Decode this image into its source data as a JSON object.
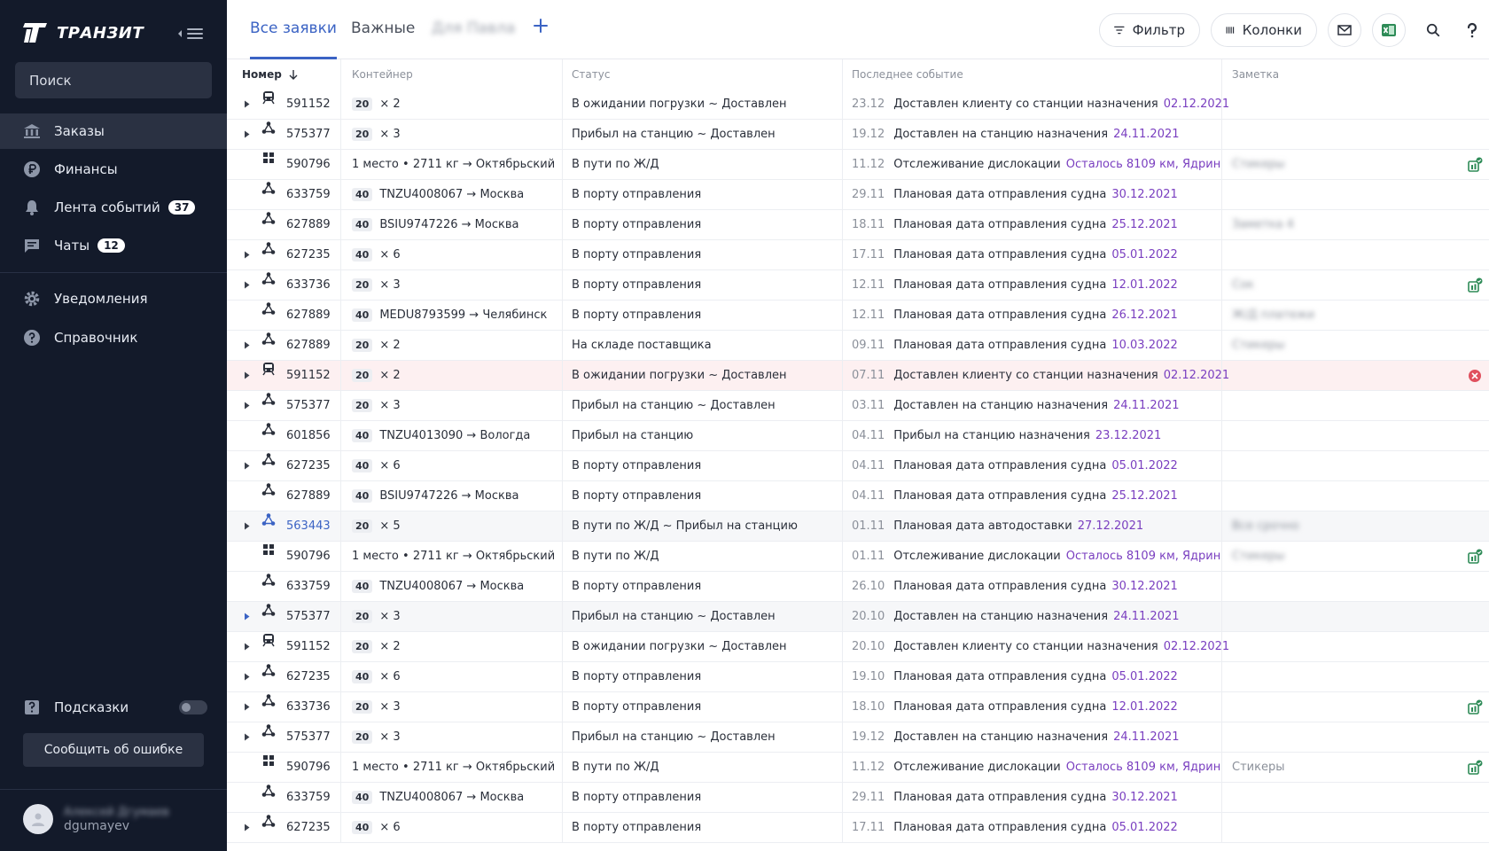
{
  "app": {
    "title": "ТРАНЗИТ"
  },
  "sidebar": {
    "search_placeholder": "Поиск",
    "items": [
      {
        "label": "Заказы",
        "icon": "bank-icon",
        "badge": "",
        "active": true
      },
      {
        "label": "Финансы",
        "icon": "ruble-icon",
        "badge": ""
      },
      {
        "label": "Лента событий",
        "icon": "bell-icon",
        "badge": "37"
      },
      {
        "label": "Чаты",
        "icon": "chat-icon",
        "badge": "12"
      },
      {
        "label": "Уведомления",
        "icon": "gear-icon",
        "badge": ""
      },
      {
        "label": "Справочник",
        "icon": "help-icon",
        "badge": ""
      }
    ],
    "hints_label": "Подсказки",
    "report_label": "Сообщить об ошибке",
    "user": {
      "name": "Алексей Дгумаев",
      "login": "dgumayev"
    }
  },
  "tabs": [
    {
      "label": "Все заявки",
      "active": true
    },
    {
      "label": "Важные"
    },
    {
      "label": "Для Павла",
      "blurred": true
    }
  ],
  "toolbar": {
    "filter_label": "Фильтр",
    "columns_label": "Колонки"
  },
  "table": {
    "columns": [
      "Номер",
      "Контейнер",
      "Статус",
      "Последнее событие",
      "Заметка"
    ],
    "rows": [
      {
        "expand": true,
        "icon": "train-icon",
        "num": "591152",
        "size": "20",
        "cont": "× 2",
        "status": "В ожидании погрузки ~ Доставлен",
        "date": "23.12",
        "event": "Доставлен клиенту со станции назначения",
        "evdate": "02.12.2021",
        "note": "",
        "action": ""
      },
      {
        "expand": true,
        "icon": "network-icon",
        "num": "575377",
        "size": "20",
        "cont": "× 3",
        "status": "Прибыл на станцию ~ Доставлен",
        "date": "19.12",
        "event": "Доставлен на станцию назначения",
        "evdate": "24.11.2021",
        "note": "",
        "action": ""
      },
      {
        "expand": false,
        "icon": "grid-icon",
        "num": "590796",
        "size": "",
        "cont": "1 место • 2711 кг → Октябрьский",
        "status": "В пути по Ж/Д",
        "date": "11.12",
        "event": "Отслеживание дислокации",
        "evdate": "Осталось 8109 км, Ядрин",
        "note": "Стикеры",
        "noteBlur": true,
        "action": "doc"
      },
      {
        "expand": false,
        "icon": "network-icon",
        "num": "633759",
        "size": "40",
        "cont": "TNZU4008067 → Москва",
        "status": "В порту отправления",
        "date": "29.11",
        "event": "Плановая дата отправления судна",
        "evdate": "30.12.2021",
        "note": "",
        "action": ""
      },
      {
        "expand": false,
        "icon": "network-icon",
        "num": "627889",
        "size": "40",
        "cont": "BSIU9747226 → Москва",
        "status": "В порту отправления",
        "date": "18.11",
        "event": "Плановая дата отправления судна",
        "evdate": "25.12.2021",
        "note": "Заметка 4",
        "noteBlur": true,
        "action": ""
      },
      {
        "expand": true,
        "icon": "network-icon",
        "num": "627235",
        "size": "40",
        "cont": "× 6",
        "status": "В порту отправления",
        "date": "17.11",
        "event": "Плановая дата отправления судна",
        "evdate": "05.01.2022",
        "note": "",
        "action": ""
      },
      {
        "expand": true,
        "icon": "network-icon",
        "num": "633736",
        "size": "20",
        "cont": "× 3",
        "status": "В порту отправления",
        "date": "12.11",
        "event": "Плановая дата отправления судна",
        "evdate": "12.01.2022",
        "note": "Сок",
        "noteBlur": true,
        "action": "doc"
      },
      {
        "expand": false,
        "icon": "network-icon",
        "num": "627889",
        "size": "40",
        "cont": "MEDU8793599 → Челябинск",
        "status": "В порту отправления",
        "date": "12.11",
        "event": "Плановая дата отправления судна",
        "evdate": "26.12.2021",
        "note": "Ж/Д платежи",
        "noteBlur": true,
        "action": ""
      },
      {
        "expand": true,
        "icon": "network-icon",
        "num": "627889",
        "size": "20",
        "cont": "× 2",
        "status": "На складе поставщика",
        "date": "09.11",
        "event": "Плановая дата отправления судна",
        "evdate": "10.03.2022",
        "note": "Стикеры",
        "noteBlur": true,
        "action": ""
      },
      {
        "expand": true,
        "icon": "train-icon",
        "num": "591152",
        "size": "20",
        "cont": "× 2",
        "status": "В ожидании погрузки ~ Доставлен",
        "date": "07.11",
        "event": "Доставлен клиенту со станции назначения",
        "evdate": "02.12.2021",
        "note": "",
        "action": "error",
        "hl": "red"
      },
      {
        "expand": true,
        "icon": "network-icon",
        "num": "575377",
        "size": "20",
        "cont": "× 3",
        "status": "Прибыл на станцию ~ Доставлен",
        "date": "03.11",
        "event": "Доставлен на станцию назначения",
        "evdate": "24.11.2021",
        "note": "",
        "action": ""
      },
      {
        "expand": false,
        "icon": "network-icon",
        "num": "601856",
        "size": "40",
        "cont": "TNZU4013090 → Вологда",
        "status": "Прибыл на станцию",
        "date": "04.11",
        "event": "Прибыл на станцию назначения",
        "evdate": "23.12.2021",
        "note": "",
        "action": ""
      },
      {
        "expand": true,
        "icon": "network-icon",
        "num": "627235",
        "size": "40",
        "cont": "× 6",
        "status": "В порту отправления",
        "date": "04.11",
        "event": "Плановая дата отправления судна",
        "evdate": "05.01.2022",
        "note": "",
        "action": ""
      },
      {
        "expand": false,
        "icon": "network-icon",
        "num": "627889",
        "size": "40",
        "cont": "BSIU9747226 → Москва",
        "status": "В порту отправления",
        "date": "04.11",
        "event": "Плановая дата отправления судна",
        "evdate": "25.12.2021",
        "note": "",
        "action": ""
      },
      {
        "expand": true,
        "icon": "network-icon",
        "num": "563443",
        "size": "20",
        "cont": "× 5",
        "status": "В пути по Ж/Д ~ Прибыл на станцию",
        "date": "01.11",
        "event": "Плановая дата автодоставки",
        "evdate": "27.12.2021",
        "note": "Все срочно",
        "noteBlur": true,
        "action": "",
        "hl": "grey",
        "link": true
      },
      {
        "expand": false,
        "icon": "grid-icon",
        "num": "590796",
        "size": "",
        "cont": "1 место • 2711 кг → Октябрьский",
        "status": "В пути по Ж/Д",
        "date": "01.11",
        "event": "Отслеживание дислокации",
        "evdate": "Осталось 8109 км, Ядрин",
        "note": "Стикеры",
        "noteBlur": true,
        "action": "doc"
      },
      {
        "expand": false,
        "icon": "network-icon",
        "num": "633759",
        "size": "40",
        "cont": "TNZU4008067 → Москва",
        "status": "В порту отправления",
        "date": "26.10",
        "event": "Плановая дата отправления судна",
        "evdate": "30.12.2021",
        "note": "",
        "action": ""
      },
      {
        "expand": true,
        "icon": "network-icon",
        "num": "575377",
        "size": "20",
        "cont": "× 3",
        "status": "Прибыл на станцию ~ Доставлен",
        "date": "20.10",
        "event": "Доставлен на станцию назначения",
        "evdate": "24.11.2021",
        "note": "",
        "action": "",
        "hl": "grey",
        "blueExpand": true
      },
      {
        "expand": true,
        "icon": "train-icon",
        "num": "591152",
        "size": "20",
        "cont": "× 2",
        "status": "В ожидании погрузки ~ Доставлен",
        "date": "20.10",
        "event": "Доставлен клиенту со станции назначения",
        "evdate": "02.12.2021",
        "note": "",
        "action": ""
      },
      {
        "expand": true,
        "icon": "network-icon",
        "num": "627235",
        "size": "40",
        "cont": "× 6",
        "status": "В порту отправления",
        "date": "19.10",
        "event": "Плановая дата отправления судна",
        "evdate": "05.01.2022",
        "note": "",
        "action": ""
      },
      {
        "expand": true,
        "icon": "network-icon",
        "num": "633736",
        "size": "20",
        "cont": "× 3",
        "status": "В порту отправления",
        "date": "18.10",
        "event": "Плановая дата отправления судна",
        "evdate": "12.01.2022",
        "note": "",
        "action": "doc"
      },
      {
        "expand": true,
        "icon": "network-icon",
        "num": "575377",
        "size": "20",
        "cont": "× 3",
        "status": "Прибыл на станцию ~ Доставлен",
        "date": "19.12",
        "event": "Доставлен на станцию назначения",
        "evdate": "24.11.2021",
        "note": "",
        "action": ""
      },
      {
        "expand": false,
        "icon": "grid-icon",
        "num": "590796",
        "size": "",
        "cont": "1 место • 2711 кг → Октябрьский",
        "status": "В пути по Ж/Д",
        "date": "11.12",
        "event": "Отслеживание дислокации",
        "evdate": "Осталось 8109 км, Ядрин",
        "note": "Стикеры",
        "noteBlur": false,
        "action": "doc"
      },
      {
        "expand": false,
        "icon": "network-icon",
        "num": "633759",
        "size": "40",
        "cont": "TNZU4008067 → Москва",
        "status": "В порту отправления",
        "date": "29.11",
        "event": "Плановая дата отправления судна",
        "evdate": "30.12.2021",
        "note": "",
        "action": ""
      },
      {
        "expand": true,
        "icon": "network-icon",
        "num": "627235",
        "size": "40",
        "cont": "× 6",
        "status": "В порту отправления",
        "date": "17.11",
        "event": "Плановая дата отправления судна",
        "evdate": "05.01.2022",
        "note": "",
        "action": ""
      }
    ]
  },
  "colors": {
    "accent": "#3b63c4",
    "sidebar_bg": "#131a2a",
    "event_date": "#7a3fc0",
    "error": "#e0505e",
    "excel": "#2e8b57"
  }
}
